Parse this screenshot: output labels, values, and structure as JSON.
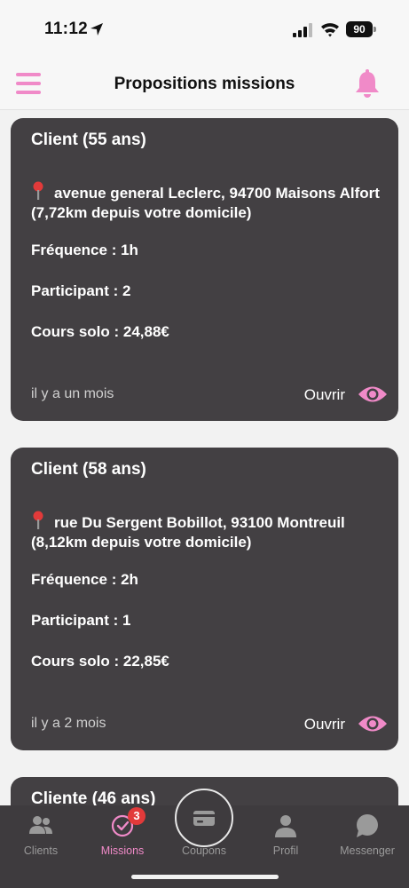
{
  "status": {
    "time": "11:12",
    "battery": "90"
  },
  "header": {
    "title": "Propositions missions"
  },
  "cards": [
    {
      "title": "Client (55 ans)",
      "address": "avenue general Leclerc, 94700 Maisons Alfort (7,72km depuis votre domicile)",
      "frequence": "Fréquence : 1h",
      "participant": "Participant : 2",
      "cours": "Cours solo : 24,88€",
      "time": "il y a un mois",
      "open_label": "Ouvrir"
    },
    {
      "title": "Client (58 ans)",
      "address": "rue Du Sergent Bobillot, 93100 Montreuil (8,12km depuis votre domicile)",
      "frequence": "Fréquence : 2h",
      "participant": "Participant : 1",
      "cours": "Cours solo : 22,85€",
      "time": "il y a 2 mois",
      "open_label": "Ouvrir"
    },
    {
      "title": "Cliente (46 ans)"
    }
  ],
  "tabs": [
    {
      "label": "Clients",
      "icon": "users-icon"
    },
    {
      "label": "Missions",
      "icon": "check-circle-icon",
      "badge": "3",
      "active": true
    },
    {
      "label": "Coupons",
      "icon": "card-icon"
    },
    {
      "label": "Profil",
      "icon": "person-icon"
    },
    {
      "label": "Messenger",
      "icon": "chat-icon"
    }
  ],
  "colors": {
    "accent": "#f08ac8",
    "card_bg": "#434043",
    "tabbar_bg": "#3e3b3e",
    "badge": "#e23a3a"
  }
}
